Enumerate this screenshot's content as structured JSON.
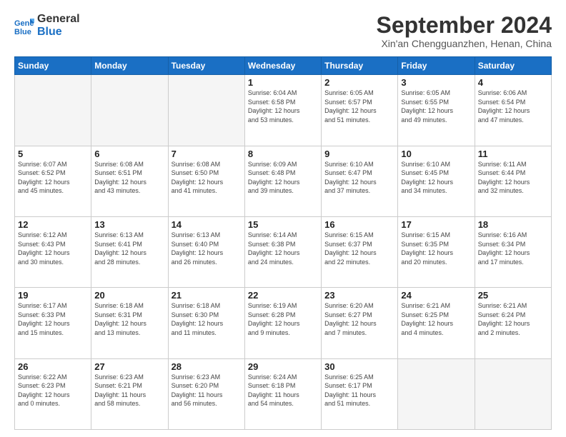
{
  "header": {
    "logo_line1": "General",
    "logo_line2": "Blue",
    "month_title": "September 2024",
    "location": "Xin'an Chengguanzhen, Henan, China"
  },
  "weekdays": [
    "Sunday",
    "Monday",
    "Tuesday",
    "Wednesday",
    "Thursday",
    "Friday",
    "Saturday"
  ],
  "days": [
    {
      "date": "",
      "info": ""
    },
    {
      "date": "",
      "info": ""
    },
    {
      "date": "",
      "info": ""
    },
    {
      "date": "1",
      "info": "Sunrise: 6:04 AM\nSunset: 6:58 PM\nDaylight: 12 hours\nand 53 minutes."
    },
    {
      "date": "2",
      "info": "Sunrise: 6:05 AM\nSunset: 6:57 PM\nDaylight: 12 hours\nand 51 minutes."
    },
    {
      "date": "3",
      "info": "Sunrise: 6:05 AM\nSunset: 6:55 PM\nDaylight: 12 hours\nand 49 minutes."
    },
    {
      "date": "4",
      "info": "Sunrise: 6:06 AM\nSunset: 6:54 PM\nDaylight: 12 hours\nand 47 minutes."
    },
    {
      "date": "5",
      "info": "Sunrise: 6:07 AM\nSunset: 6:52 PM\nDaylight: 12 hours\nand 45 minutes."
    },
    {
      "date": "6",
      "info": "Sunrise: 6:08 AM\nSunset: 6:51 PM\nDaylight: 12 hours\nand 43 minutes."
    },
    {
      "date": "7",
      "info": "Sunrise: 6:08 AM\nSunset: 6:50 PM\nDaylight: 12 hours\nand 41 minutes."
    },
    {
      "date": "8",
      "info": "Sunrise: 6:09 AM\nSunset: 6:48 PM\nDaylight: 12 hours\nand 39 minutes."
    },
    {
      "date": "9",
      "info": "Sunrise: 6:10 AM\nSunset: 6:47 PM\nDaylight: 12 hours\nand 37 minutes."
    },
    {
      "date": "10",
      "info": "Sunrise: 6:10 AM\nSunset: 6:45 PM\nDaylight: 12 hours\nand 34 minutes."
    },
    {
      "date": "11",
      "info": "Sunrise: 6:11 AM\nSunset: 6:44 PM\nDaylight: 12 hours\nand 32 minutes."
    },
    {
      "date": "12",
      "info": "Sunrise: 6:12 AM\nSunset: 6:43 PM\nDaylight: 12 hours\nand 30 minutes."
    },
    {
      "date": "13",
      "info": "Sunrise: 6:13 AM\nSunset: 6:41 PM\nDaylight: 12 hours\nand 28 minutes."
    },
    {
      "date": "14",
      "info": "Sunrise: 6:13 AM\nSunset: 6:40 PM\nDaylight: 12 hours\nand 26 minutes."
    },
    {
      "date": "15",
      "info": "Sunrise: 6:14 AM\nSunset: 6:38 PM\nDaylight: 12 hours\nand 24 minutes."
    },
    {
      "date": "16",
      "info": "Sunrise: 6:15 AM\nSunset: 6:37 PM\nDaylight: 12 hours\nand 22 minutes."
    },
    {
      "date": "17",
      "info": "Sunrise: 6:15 AM\nSunset: 6:35 PM\nDaylight: 12 hours\nand 20 minutes."
    },
    {
      "date": "18",
      "info": "Sunrise: 6:16 AM\nSunset: 6:34 PM\nDaylight: 12 hours\nand 17 minutes."
    },
    {
      "date": "19",
      "info": "Sunrise: 6:17 AM\nSunset: 6:33 PM\nDaylight: 12 hours\nand 15 minutes."
    },
    {
      "date": "20",
      "info": "Sunrise: 6:18 AM\nSunset: 6:31 PM\nDaylight: 12 hours\nand 13 minutes."
    },
    {
      "date": "21",
      "info": "Sunrise: 6:18 AM\nSunset: 6:30 PM\nDaylight: 12 hours\nand 11 minutes."
    },
    {
      "date": "22",
      "info": "Sunrise: 6:19 AM\nSunset: 6:28 PM\nDaylight: 12 hours\nand 9 minutes."
    },
    {
      "date": "23",
      "info": "Sunrise: 6:20 AM\nSunset: 6:27 PM\nDaylight: 12 hours\nand 7 minutes."
    },
    {
      "date": "24",
      "info": "Sunrise: 6:21 AM\nSunset: 6:25 PM\nDaylight: 12 hours\nand 4 minutes."
    },
    {
      "date": "25",
      "info": "Sunrise: 6:21 AM\nSunset: 6:24 PM\nDaylight: 12 hours\nand 2 minutes."
    },
    {
      "date": "26",
      "info": "Sunrise: 6:22 AM\nSunset: 6:23 PM\nDaylight: 12 hours\nand 0 minutes."
    },
    {
      "date": "27",
      "info": "Sunrise: 6:23 AM\nSunset: 6:21 PM\nDaylight: 11 hours\nand 58 minutes."
    },
    {
      "date": "28",
      "info": "Sunrise: 6:23 AM\nSunset: 6:20 PM\nDaylight: 11 hours\nand 56 minutes."
    },
    {
      "date": "29",
      "info": "Sunrise: 6:24 AM\nSunset: 6:18 PM\nDaylight: 11 hours\nand 54 minutes."
    },
    {
      "date": "30",
      "info": "Sunrise: 6:25 AM\nSunset: 6:17 PM\nDaylight: 11 hours\nand 51 minutes."
    },
    {
      "date": "",
      "info": ""
    },
    {
      "date": "",
      "info": ""
    },
    {
      "date": "",
      "info": ""
    }
  ]
}
